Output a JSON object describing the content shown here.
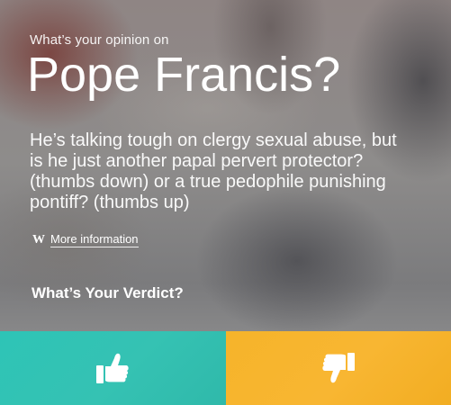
{
  "question": {
    "kicker": "What’s your opinion on",
    "title": "Pope Francis?",
    "description": "He’s talking tough on clergy sexual abuse, but is he just another papal pervert protector? (thumbs down) or a true pedophile punishing pontiff? (thumbs up)"
  },
  "more_info": {
    "icon_glyph": "W",
    "label": "More information"
  },
  "verdict": {
    "label": "What’s Your Verdict?"
  },
  "buttons": {
    "thumbs_up": {
      "icon": "thumbs-up-icon",
      "color": "#2ec4b6"
    },
    "thumbs_down": {
      "icon": "thumbs-down-icon",
      "color": "#f6b42a"
    }
  }
}
